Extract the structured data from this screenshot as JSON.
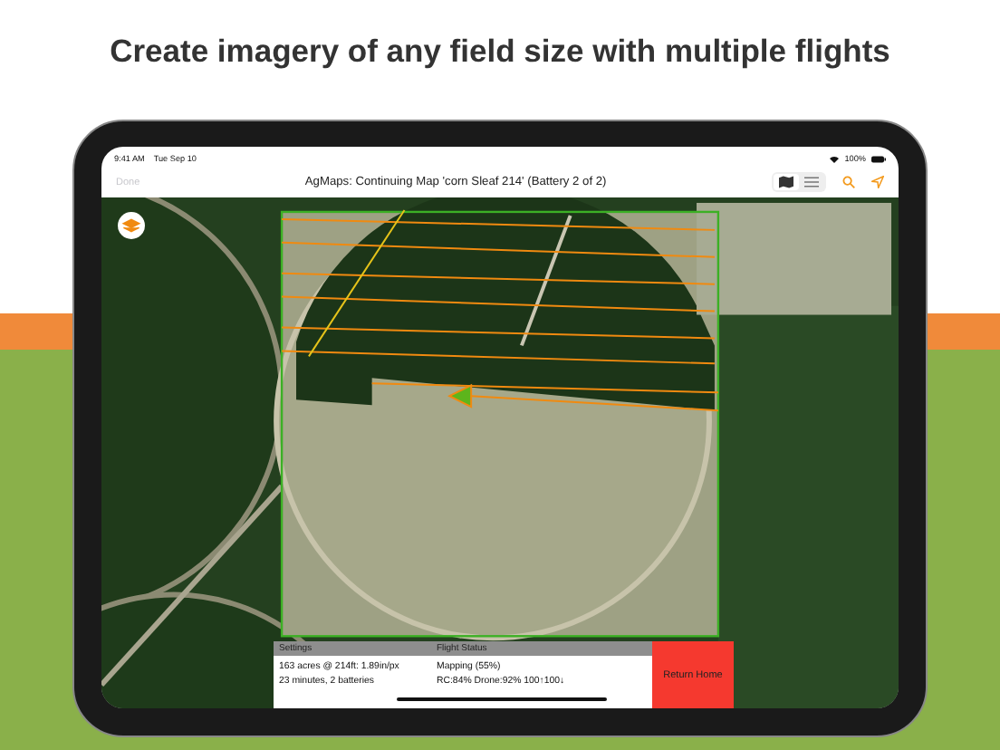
{
  "headline": "Create imagery of any field size with multiple flights",
  "status_bar": {
    "time": "9:41 AM",
    "date": "Tue Sep 10",
    "battery": "100%"
  },
  "nav_bar": {
    "done": {
      "label": "Done",
      "disabled": true
    },
    "title": "AgMaps: Continuing Map 'corn Sleaf 214' (Battery 2 of 2)",
    "view_modes": [
      {
        "kind": "map",
        "selected": true
      },
      {
        "kind": "list",
        "selected": false
      }
    ]
  },
  "panel": {
    "sections": [
      {
        "heading": "Settings",
        "lines": [
          "163 acres @ 214ft: 1.89in/px",
          "23 minutes, 2 batteries"
        ]
      },
      {
        "heading": "Flight Status",
        "lines": [
          "Mapping (55%)",
          "RC:84% Drone:92% 100↑100↓"
        ]
      }
    ],
    "return_button": "Return Home"
  }
}
